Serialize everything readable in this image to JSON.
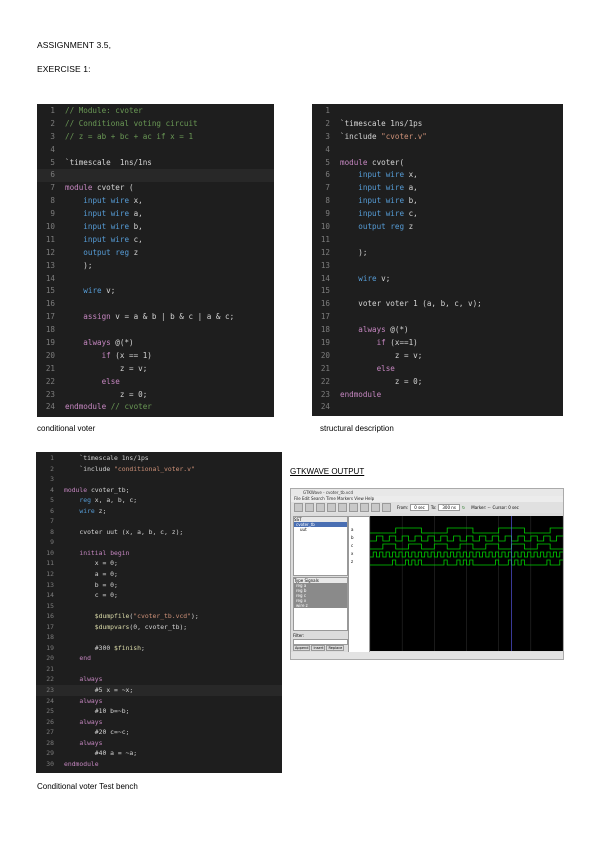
{
  "header": {
    "assignment": "ASSIGNMENT 3.5,",
    "exercise": "EXERCISE 1:"
  },
  "captions": {
    "conditional_voter": "conditional voter",
    "structural": "structural description",
    "testbench": "Conditional voter Test bench",
    "gtkwave": "GTKWAVE OUTPUT"
  },
  "code1": [
    {
      "n": "1",
      "t": "// Module: cvoter",
      "k": "com"
    },
    {
      "n": "2",
      "t": "// Conditional voting circuit",
      "k": "com"
    },
    {
      "n": "3",
      "t": "// z = ab + bc + ac if x = 1",
      "k": "com"
    },
    {
      "n": "4",
      "t": "",
      "k": ""
    },
    {
      "n": "5",
      "t": "`timescale  1ns/1ns",
      "k": "dir"
    },
    {
      "n": "6",
      "t": "",
      "k": "cur"
    },
    {
      "n": "7",
      "t": "module cvoter (",
      "k": "kw"
    },
    {
      "n": "8",
      "t": "    input wire x,",
      "k": "ty"
    },
    {
      "n": "9",
      "t": "    input wire a,",
      "k": "ty"
    },
    {
      "n": "10",
      "t": "    input wire b,",
      "k": "ty"
    },
    {
      "n": "11",
      "t": "    input wire c,",
      "k": "ty"
    },
    {
      "n": "12",
      "t": "    output reg z",
      "k": "ty"
    },
    {
      "n": "13",
      "t": "    );",
      "k": ""
    },
    {
      "n": "14",
      "t": "",
      "k": ""
    },
    {
      "n": "15",
      "t": "    wire v;",
      "k": "ty"
    },
    {
      "n": "16",
      "t": "",
      "k": ""
    },
    {
      "n": "17",
      "t": "    assign v = a & b | b & c | a & c;",
      "k": "ty"
    },
    {
      "n": "18",
      "t": "",
      "k": ""
    },
    {
      "n": "19",
      "t": "    always @(*)",
      "k": "kw"
    },
    {
      "n": "20",
      "t": "        if (x == 1)",
      "k": "kw"
    },
    {
      "n": "21",
      "t": "            z = v;",
      "k": ""
    },
    {
      "n": "22",
      "t": "        else",
      "k": "kw"
    },
    {
      "n": "23",
      "t": "            z = 0;",
      "k": ""
    },
    {
      "n": "24",
      "t": "endmodule // cvoter",
      "k": "kw"
    }
  ],
  "code2": [
    {
      "n": "1",
      "t": "",
      "k": ""
    },
    {
      "n": "2",
      "t": "`timescale 1ns/1ps",
      "k": "dir"
    },
    {
      "n": "3",
      "t": "`include \"cvoter.v\"",
      "k": "str"
    },
    {
      "n": "4",
      "t": "",
      "k": ""
    },
    {
      "n": "5",
      "t": "module cvoter(",
      "k": "kw"
    },
    {
      "n": "6",
      "t": "    input wire x,",
      "k": "ty"
    },
    {
      "n": "7",
      "t": "    input wire a,",
      "k": "ty"
    },
    {
      "n": "8",
      "t": "    input wire b,",
      "k": "ty"
    },
    {
      "n": "9",
      "t": "    input wire c,",
      "k": "ty"
    },
    {
      "n": "10",
      "t": "    output reg z",
      "k": "ty"
    },
    {
      "n": "11",
      "t": "",
      "k": ""
    },
    {
      "n": "12",
      "t": "    );",
      "k": ""
    },
    {
      "n": "13",
      "t": "",
      "k": ""
    },
    {
      "n": "14",
      "t": "    wire v;",
      "k": "ty"
    },
    {
      "n": "15",
      "t": "",
      "k": ""
    },
    {
      "n": "16",
      "t": "    voter voter 1 (a, b, c, v);",
      "k": ""
    },
    {
      "n": "17",
      "t": "",
      "k": ""
    },
    {
      "n": "18",
      "t": "    always @(*)",
      "k": "kw"
    },
    {
      "n": "19",
      "t": "        if (x==1)",
      "k": "kw"
    },
    {
      "n": "20",
      "t": "            z = v;",
      "k": ""
    },
    {
      "n": "21",
      "t": "        else",
      "k": "kw"
    },
    {
      "n": "22",
      "t": "            z = 0;",
      "k": ""
    },
    {
      "n": "23",
      "t": "endmodule",
      "k": "kw"
    },
    {
      "n": "24",
      "t": "",
      "k": ""
    }
  ],
  "code3": [
    {
      "n": "1",
      "t": "    `timescale 1ns/1ps",
      "k": "dir"
    },
    {
      "n": "2",
      "t": "    `include \"conditional_voter.v\"",
      "k": "str"
    },
    {
      "n": "3",
      "t": "",
      "k": ""
    },
    {
      "n": "4",
      "t": "module cvoter_tb;",
      "k": "kw"
    },
    {
      "n": "5",
      "t": "    reg x, a, b, c;",
      "k": "ty"
    },
    {
      "n": "6",
      "t": "    wire z;",
      "k": "ty"
    },
    {
      "n": "7",
      "t": "",
      "k": ""
    },
    {
      "n": "8",
      "t": "    cvoter uut (x, a, b, c, z);",
      "k": ""
    },
    {
      "n": "9",
      "t": "",
      "k": ""
    },
    {
      "n": "10",
      "t": "    initial begin",
      "k": "kw"
    },
    {
      "n": "11",
      "t": "        x = 0;",
      "k": ""
    },
    {
      "n": "12",
      "t": "        a = 0;",
      "k": ""
    },
    {
      "n": "13",
      "t": "        b = 0;",
      "k": ""
    },
    {
      "n": "14",
      "t": "        c = 0;",
      "k": ""
    },
    {
      "n": "15",
      "t": "",
      "k": ""
    },
    {
      "n": "16",
      "t": "        $dumpfile(\"cvoter_tb.vcd\");",
      "k": "fn"
    },
    {
      "n": "17",
      "t": "        $dumpvars(0, cvoter_tb);",
      "k": "fn"
    },
    {
      "n": "18",
      "t": "",
      "k": ""
    },
    {
      "n": "19",
      "t": "        #300 $finish;",
      "k": "fn"
    },
    {
      "n": "20",
      "t": "    end",
      "k": "kw"
    },
    {
      "n": "21",
      "t": "",
      "k": ""
    },
    {
      "n": "22",
      "t": "    always",
      "k": "kw"
    },
    {
      "n": "23",
      "t": "        #5 x = ~x;",
      "k": "cur"
    },
    {
      "n": "24",
      "t": "    always",
      "k": "kw"
    },
    {
      "n": "25",
      "t": "        #10 b=~b;",
      "k": ""
    },
    {
      "n": "26",
      "t": "    always",
      "k": "kw"
    },
    {
      "n": "27",
      "t": "        #20 c=~c;",
      "k": ""
    },
    {
      "n": "28",
      "t": "    always",
      "k": "kw"
    },
    {
      "n": "29",
      "t": "        #40 a = ~a;",
      "k": ""
    },
    {
      "n": "30",
      "t": "endmodule",
      "k": "kw"
    }
  ],
  "gtkwave": {
    "title": "GTKWave - cvoter_tb.vcd",
    "menu": "File  Edit  Search  Time  Markers  View  Help",
    "sst_label": "SST",
    "tree_item": "cvoter_tb",
    "uut_item": "uut",
    "type_signals_header": "Type  Signals",
    "signals_list": [
      "reg a",
      "reg b",
      "reg c",
      "reg x",
      "wire z"
    ],
    "wave_signals": [
      "a",
      "b",
      "c",
      "x",
      "z"
    ],
    "filter_label": "Filter:",
    "buttons": [
      "Append",
      "Insert",
      "Replace"
    ],
    "from_label": "From:",
    "from_value": "0 sec",
    "to_label": "To:",
    "to_value": "300 ns",
    "marker_label": "Marker: --",
    "cursor_label": "Cursor: 0 sec"
  },
  "colors": {
    "code_bg": "#1e1e1e",
    "comment": "#6a9955",
    "keyword": "#c586c0",
    "type": "#569cd6",
    "wave_green": "#00d000"
  }
}
